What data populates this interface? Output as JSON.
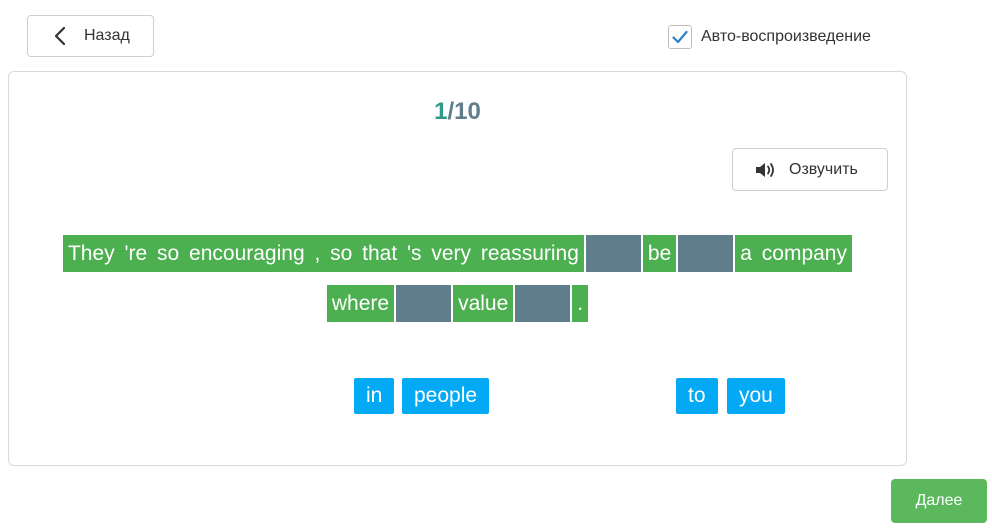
{
  "header": {
    "back_label": "Назад",
    "autoplay_label": "Авто-воспроизведение",
    "autoplay_checked": true
  },
  "exercise": {
    "counter_current": "1",
    "counter_total": "/10",
    "speak_label": "Озвучить",
    "line1": [
      "They 're so encouraging , so that 's very reassuring",
      "",
      "be",
      "",
      "a company"
    ],
    "line2": [
      "where",
      "",
      "value",
      "",
      "."
    ],
    "options": [
      "in",
      "people",
      "to",
      "you"
    ]
  },
  "footer": {
    "next_label": "Далее"
  },
  "colors": {
    "chunk": "#4caf50",
    "blank": "#607d8b",
    "option": "#03a9f4",
    "next": "#5cb85c",
    "counter_current": "#2e9a8a",
    "counter_total": "#607d8b"
  },
  "icons": {
    "back": "chevron-left-icon",
    "checkbox": "checkmark-icon",
    "speak": "speaker-icon"
  }
}
